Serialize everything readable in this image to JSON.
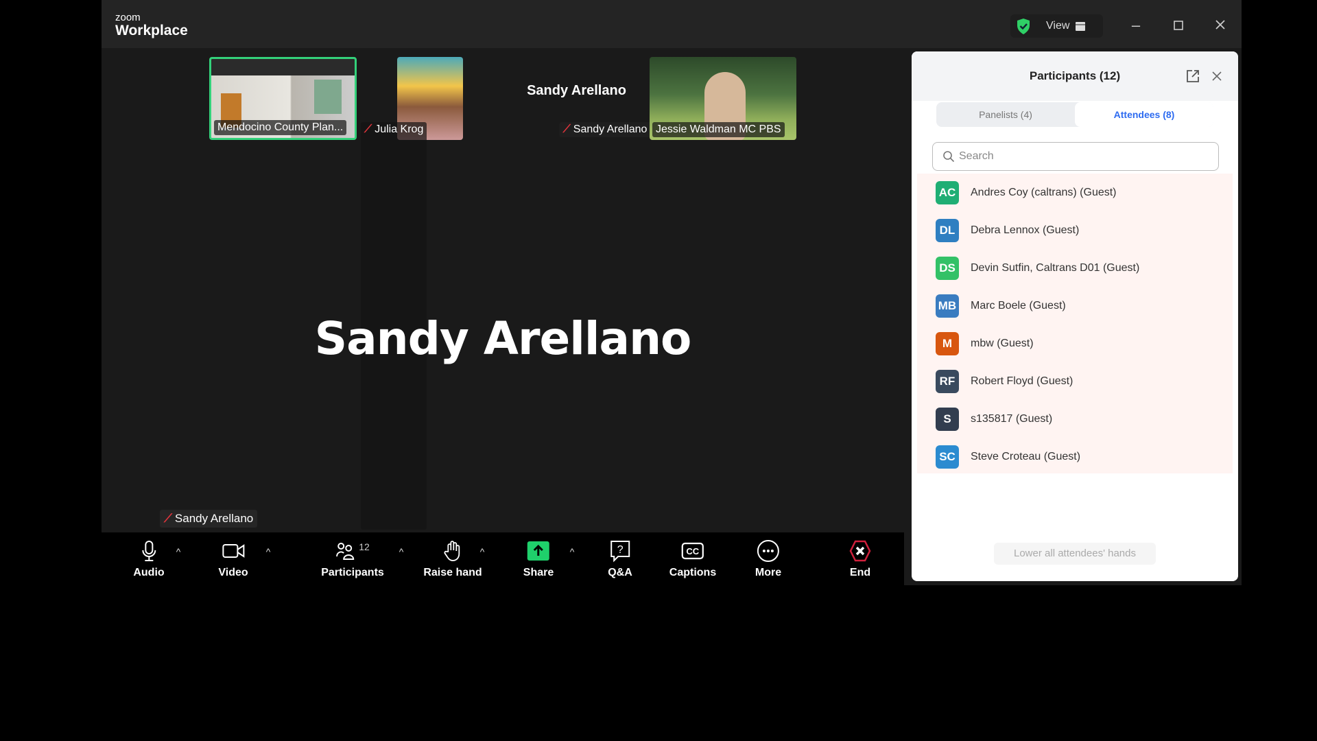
{
  "app": {
    "logo_small": "zoom",
    "logo_main": "Workplace",
    "view_label": "View"
  },
  "colors": {
    "accent": "#2d6bf0",
    "active_speaker_border": "#33d17a",
    "share_green": "#1fd06b",
    "end_red": "#d0203c",
    "muted_red": "#e2343c"
  },
  "thumbnails": [
    {
      "label": "Mendocino County Plan...",
      "active": true,
      "video": true
    },
    {
      "label": "Julia Krog",
      "muted": true,
      "video": true
    },
    {
      "name": "Sandy Arellano",
      "label": "Sandy Arellano",
      "muted": true,
      "video": false
    },
    {
      "label": "Jessie Waldman MC PBS",
      "video": true
    }
  ],
  "main": {
    "speaker_name": "Sandy Arellano",
    "speaker_label": "Sandy Arellano"
  },
  "toolbar": {
    "audio": "Audio",
    "video": "Video",
    "participants": "Participants",
    "participants_count": "12",
    "raise_hand": "Raise hand",
    "share": "Share",
    "qa": "Q&A",
    "captions": "Captions",
    "more": "More",
    "end": "End"
  },
  "panel": {
    "title": "Participants (12)",
    "tabs": [
      {
        "label": "Panelists (4)",
        "active": false
      },
      {
        "label": "Attendees (8)",
        "active": true
      }
    ],
    "search_placeholder": "Search",
    "attendees": [
      {
        "initials": "AC",
        "name": "Andres Coy (caltrans) (Guest)",
        "color": "#1fae74"
      },
      {
        "initials": "DL",
        "name": "Debra Lennox (Guest)",
        "color": "#2f7fc1"
      },
      {
        "initials": "DS",
        "name": "Devin Sutfin, Caltrans D01 (Guest)",
        "color": "#33c167"
      },
      {
        "initials": "MB",
        "name": "Marc Boele (Guest)",
        "color": "#3a7cc0"
      },
      {
        "initials": "M",
        "name": "mbw (Guest)",
        "color": "#d8560f"
      },
      {
        "initials": "RF",
        "name": "Robert Floyd (Guest)",
        "color": "#3a4a5e"
      },
      {
        "initials": "S",
        "name": "s135817 (Guest)",
        "color": "#323d4f"
      },
      {
        "initials": "SC",
        "name": "Steve Croteau (Guest)",
        "color": "#2b8bd0"
      }
    ],
    "lower_hands": "Lower all attendees' hands"
  }
}
